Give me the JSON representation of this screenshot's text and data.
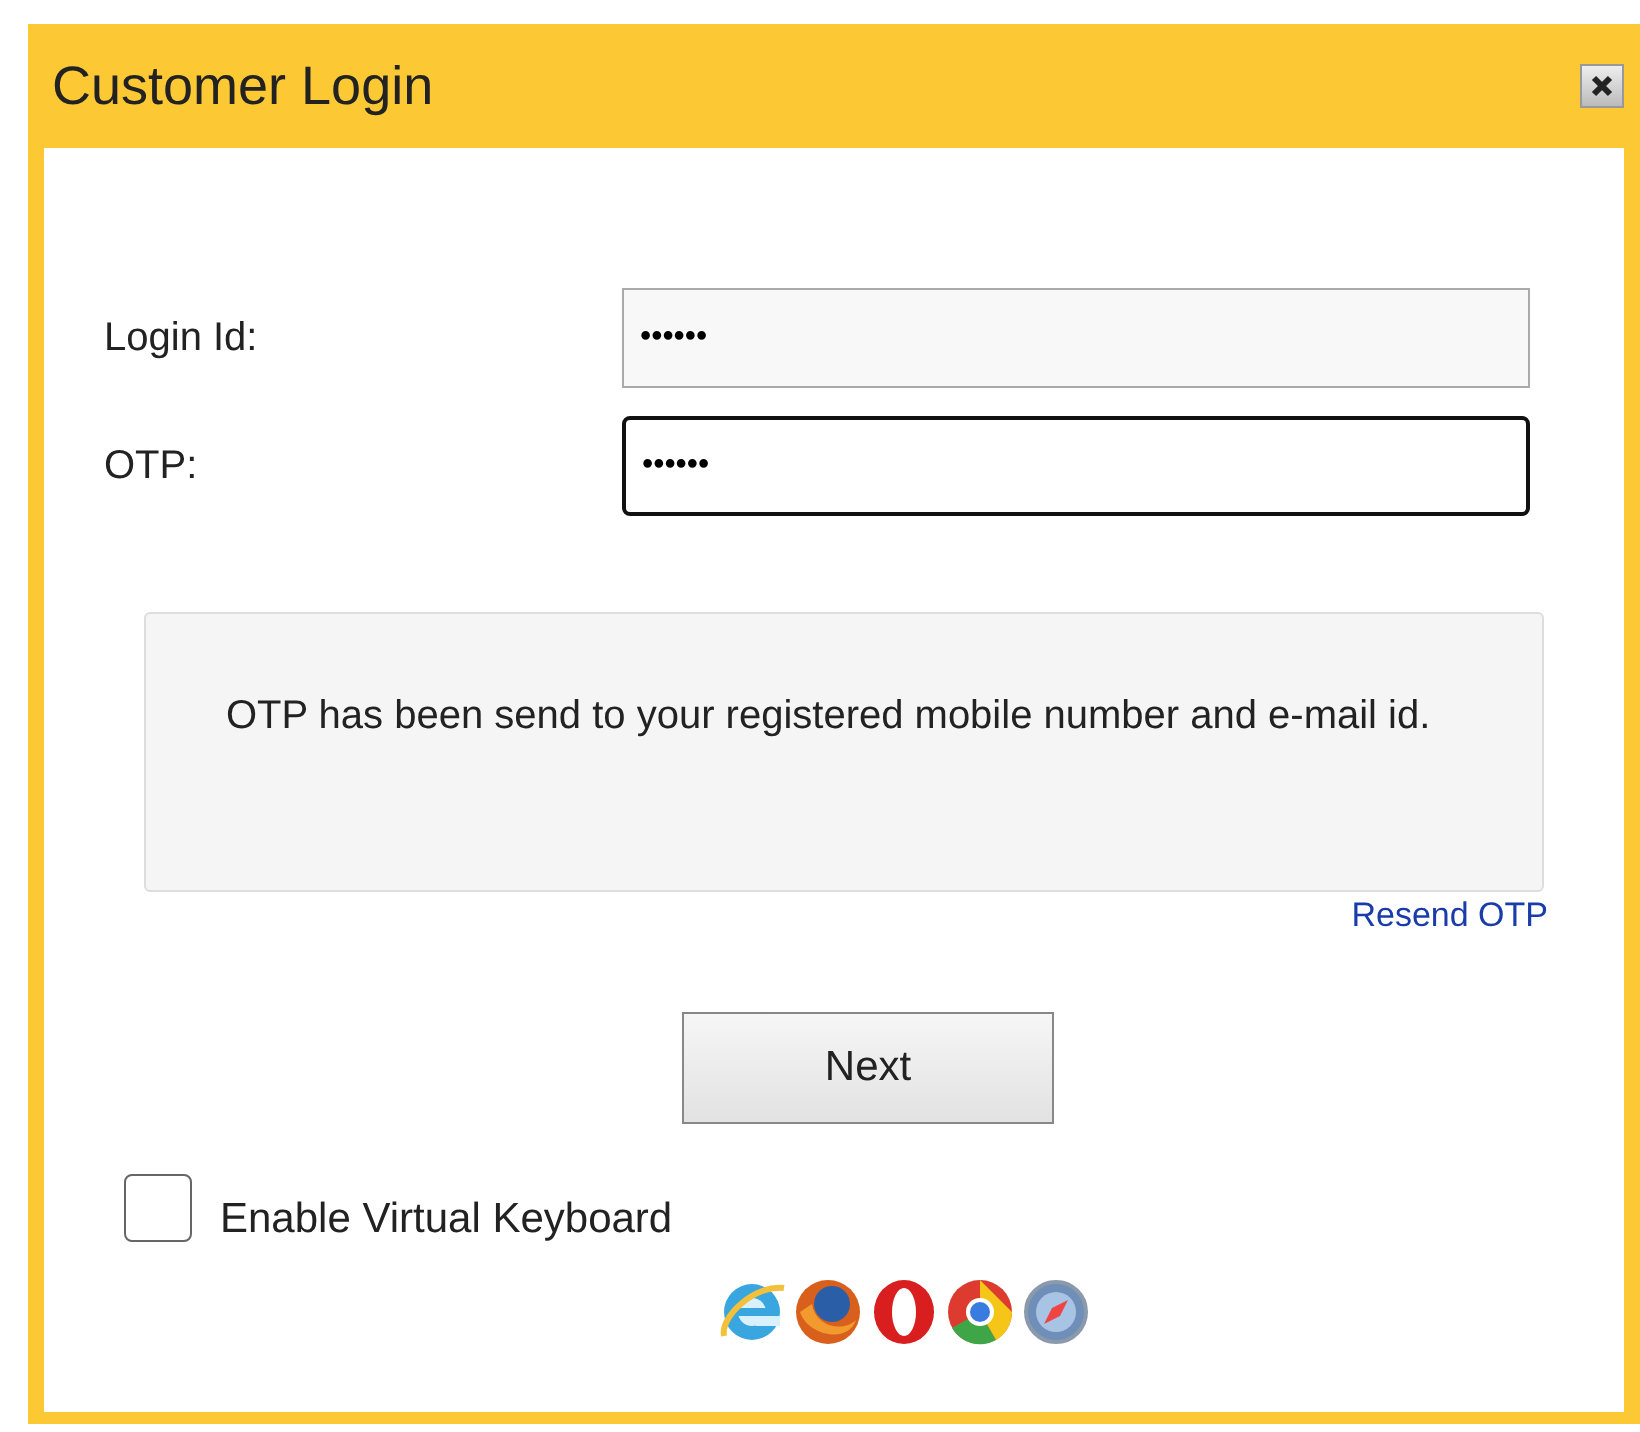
{
  "window": {
    "title": "Customer Login"
  },
  "fields": [
    {
      "label": "Login Id:",
      "value": "••••••",
      "focused": false
    },
    {
      "label": "OTP:",
      "value": "••••••",
      "focused": true
    }
  ],
  "message": "OTP has been send to your registered mobile number and e-mail id.",
  "resend_link": "Resend OTP",
  "next_button": "Next",
  "virtual_keyboard": {
    "label": "Enable Virtual Keyboard",
    "checked": false
  }
}
